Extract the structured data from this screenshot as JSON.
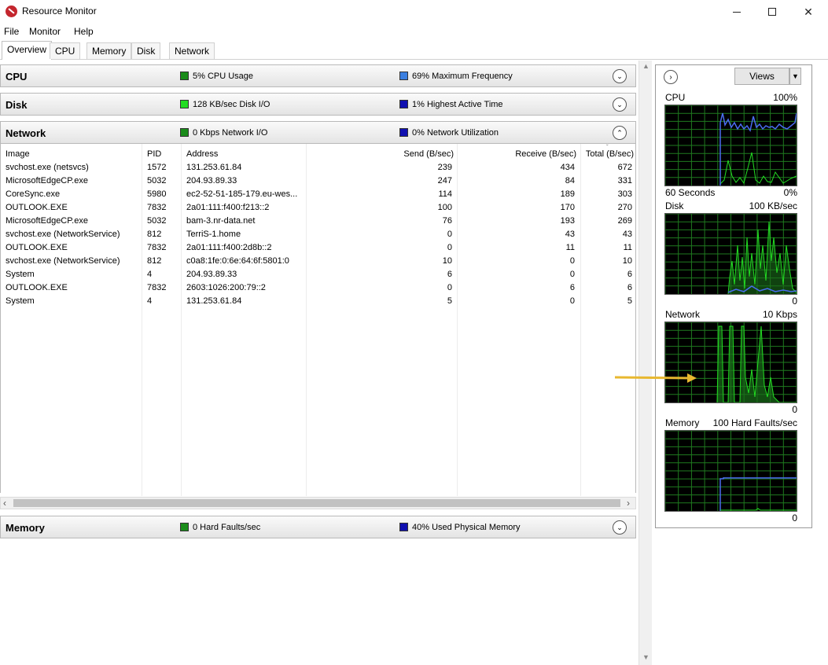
{
  "window": {
    "title": "Resource Monitor",
    "minimize": "—",
    "maximize": "☐",
    "close": "✕"
  },
  "menu": [
    "File",
    "Monitor",
    "Help"
  ],
  "tabs": [
    "Overview",
    "CPU",
    "Memory",
    "Disk",
    "Network"
  ],
  "sections": {
    "cpu": {
      "title": "CPU",
      "stat1": "5% CPU Usage",
      "stat2": "69% Maximum Frequency",
      "color1": "#1a8c1a",
      "color2": "#3b7fe0"
    },
    "disk": {
      "title": "Disk",
      "stat1": "128 KB/sec Disk I/O",
      "stat2": "1% Highest Active Time",
      "color1": "#22dd22",
      "color2": "#1010b0"
    },
    "network": {
      "title": "Network",
      "stat1": "0 Kbps Network I/O",
      "stat2": "0% Network Utilization",
      "color1": "#1a8c1a",
      "color2": "#1010b0"
    },
    "memory": {
      "title": "Memory",
      "stat1": "0 Hard Faults/sec",
      "stat2": "40% Used Physical Memory",
      "color1": "#1a8c1a",
      "color2": "#1010b0"
    }
  },
  "network_table": {
    "columns": [
      "Image",
      "PID",
      "Address",
      "Send (B/sec)",
      "Receive (B/sec)",
      "Total (B/sec)"
    ],
    "rows": [
      [
        "svchost.exe (netsvcs)",
        "1572",
        "131.253.61.84",
        "239",
        "434",
        "672"
      ],
      [
        "MicrosoftEdgeCP.exe",
        "5032",
        "204.93.89.33",
        "247",
        "84",
        "331"
      ],
      [
        "CoreSync.exe",
        "5980",
        "ec2-52-51-185-179.eu-wes...",
        "114",
        "189",
        "303"
      ],
      [
        "OUTLOOK.EXE",
        "7832",
        "2a01:111:f400:f213::2",
        "100",
        "170",
        "270"
      ],
      [
        "MicrosoftEdgeCP.exe",
        "5032",
        "bam-3.nr-data.net",
        "76",
        "193",
        "269"
      ],
      [
        "svchost.exe (NetworkService)",
        "812",
        "TerriS-1.home",
        "0",
        "43",
        "43"
      ],
      [
        "OUTLOOK.EXE",
        "7832",
        "2a01:111:f400:2d8b::2",
        "0",
        "11",
        "11"
      ],
      [
        "svchost.exe (NetworkService)",
        "812",
        "c0a8:1fe:0:6e:64:6f:5801:0",
        "10",
        "0",
        "10"
      ],
      [
        "System",
        "4",
        "204.93.89.33",
        "6",
        "0",
        "6"
      ],
      [
        "OUTLOOK.EXE",
        "7832",
        "2603:1026:200:79::2",
        "0",
        "6",
        "6"
      ],
      [
        "System",
        "4",
        "131.253.61.84",
        "5",
        "0",
        "5"
      ]
    ]
  },
  "graphs": {
    "views_label": "Views",
    "cpu": {
      "title": "CPU",
      "max": "100%",
      "footer_left": "60 Seconds",
      "footer_right": "0%"
    },
    "disk": {
      "title": "Disk",
      "max": "100 KB/sec",
      "footer_right": "0"
    },
    "network": {
      "title": "Network",
      "max": "10 Kbps",
      "footer_right": "0"
    },
    "memory": {
      "title": "Memory",
      "max": "100 Hard Faults/sec",
      "footer_right": "0"
    }
  },
  "colors": {
    "graph_bg": "#000000",
    "grid": "#1f7a1f",
    "green_line": "#22dd22",
    "blue_line": "#4a6cf0",
    "annotation": "#e8b830"
  }
}
